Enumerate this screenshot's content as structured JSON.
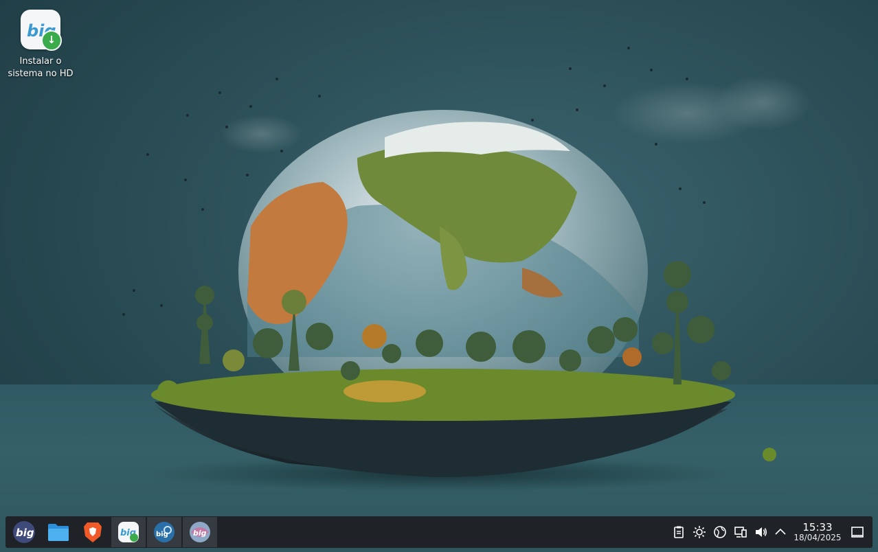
{
  "desktop": {
    "icon": {
      "label": "Instalar o sistema no HD",
      "name": "biglinux-installer-icon"
    }
  },
  "wallpaper": {
    "subject": "floating-earth-island",
    "colors": {
      "sky": "#2c4f58",
      "floor": "#356068",
      "grass": "#6a8a2c",
      "ocean": "#4f7f8c",
      "land": "#c27a3e"
    }
  },
  "taskbar": {
    "apps": [
      {
        "name": "biglinux-menu-icon",
        "active": false
      },
      {
        "name": "file-manager-icon",
        "active": false
      },
      {
        "name": "brave-browser-icon",
        "active": false
      },
      {
        "name": "biglinux-installer-icon",
        "active": true
      },
      {
        "name": "biglinux-control-center-icon",
        "active": true
      },
      {
        "name": "biglinux-theme-icon",
        "active": true
      }
    ],
    "tray": [
      "clipboard-icon",
      "brightness-icon",
      "network-globe-icon",
      "display-icon",
      "volume-icon",
      "chevron-up-icon"
    ],
    "clock": {
      "time": "15:33",
      "date": "18/04/2025"
    }
  }
}
